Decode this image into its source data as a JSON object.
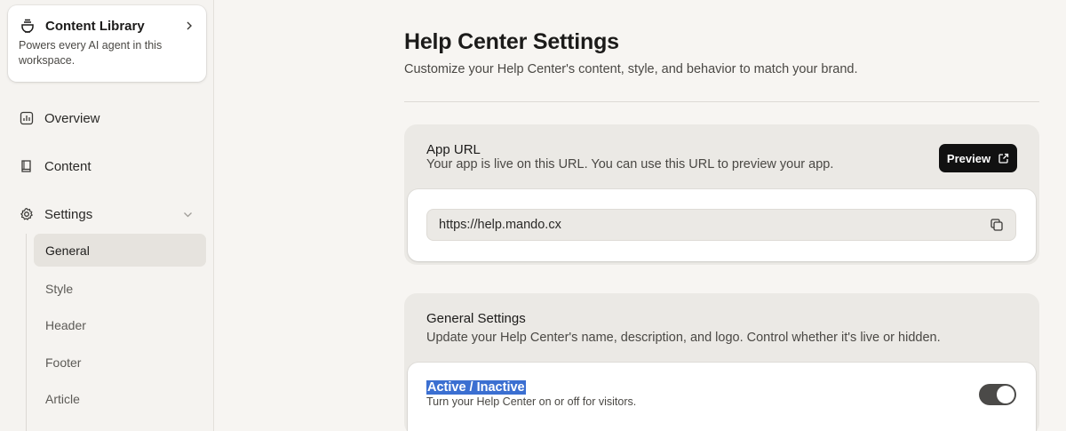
{
  "sidebar": {
    "library": {
      "title": "Content Library",
      "description": "Powers every AI agent in this workspace.",
      "icon": "bowl-icon"
    },
    "nav": [
      {
        "label": "Overview",
        "icon": "chart-icon"
      },
      {
        "label": "Content",
        "icon": "book-icon"
      },
      {
        "label": "Settings",
        "icon": "gear-icon"
      }
    ],
    "settings_sub": [
      {
        "label": "General",
        "active": true
      },
      {
        "label": "Style",
        "active": false
      },
      {
        "label": "Header",
        "active": false
      },
      {
        "label": "Footer",
        "active": false
      },
      {
        "label": "Article",
        "active": false
      }
    ]
  },
  "page": {
    "title": "Help Center Settings",
    "description": "Customize your Help Center's content, style, and behavior to match your brand."
  },
  "app_url": {
    "title": "App URL",
    "description": "Your app is live on this URL. You can use this URL to preview your app.",
    "preview_label": "Preview",
    "url": "https://help.mando.cx"
  },
  "general": {
    "title": "General Settings",
    "description": "Update your Help Center's name, description, and logo. Control whether it's live or hidden.",
    "toggle_label": "Active / Inactive",
    "toggle_description": "Turn your Help Center on or off for visitors.",
    "toggle_on": true
  },
  "colors": {
    "background": "#f7f5f2",
    "section": "#ebe9e5",
    "button": "#111111",
    "selection": "#3b6fd1"
  }
}
